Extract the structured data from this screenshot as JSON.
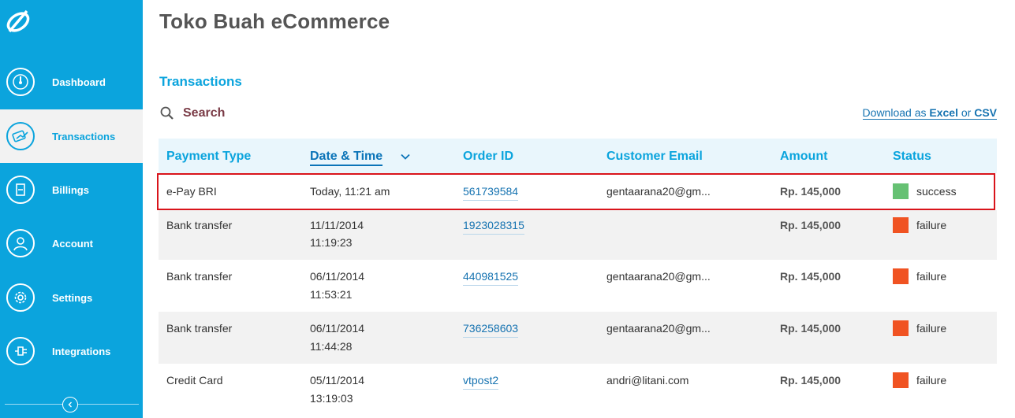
{
  "app": {
    "title": "Toko Buah eCommerce"
  },
  "sidebar": {
    "items": [
      {
        "label": "Dashboard",
        "icon": "gauge-icon",
        "active": false
      },
      {
        "label": "Transactions",
        "icon": "transactions-icon",
        "active": true
      },
      {
        "label": "Billings",
        "icon": "billing-icon",
        "active": false
      },
      {
        "label": "Account",
        "icon": "user-icon",
        "active": false
      },
      {
        "label": "Settings",
        "icon": "gear-icon",
        "active": false
      },
      {
        "label": "Integrations",
        "icon": "plug-icon",
        "active": false
      }
    ]
  },
  "main": {
    "section_title": "Transactions",
    "search_label": "Search",
    "download": {
      "prefix": "Download as ",
      "excel": "Excel",
      "or": " or ",
      "csv": "CSV"
    }
  },
  "table": {
    "columns": [
      "Payment Type",
      "Date & Time",
      "Order ID",
      "Customer Email",
      "Amount",
      "Status"
    ],
    "sorted_column": "Date & Time",
    "rows": [
      {
        "payment": "e-Pay BRI",
        "date": "Today, 11:21 am",
        "time": "",
        "order": "561739584",
        "email": "gentaarana20@gm...",
        "amount": "Rp. 145,000",
        "status": "success"
      },
      {
        "payment": "Bank transfer",
        "date": "11/11/2014",
        "time": "11:19:23",
        "order": "1923028315",
        "email": "",
        "amount": "Rp. 145,000",
        "status": "failure"
      },
      {
        "payment": "Bank transfer",
        "date": "06/11/2014",
        "time": "11:53:21",
        "order": "440981525",
        "email": "gentaarana20@gm...",
        "amount": "Rp. 145,000",
        "status": "failure"
      },
      {
        "payment": "Bank transfer",
        "date": "06/11/2014",
        "time": "11:44:28",
        "order": "736258603",
        "email": "gentaarana20@gm...",
        "amount": "Rp. 145,000",
        "status": "failure"
      },
      {
        "payment": "Credit Card",
        "date": "05/11/2014",
        "time": "13:19:03",
        "order": "vtpost2",
        "email": "andri@litani.com",
        "amount": "Rp. 145,000",
        "status": "failure"
      }
    ]
  },
  "colors": {
    "sidebar": "#0ba4dd",
    "success": "#66c173",
    "failure": "#f05322",
    "highlight": "#d9141b"
  }
}
